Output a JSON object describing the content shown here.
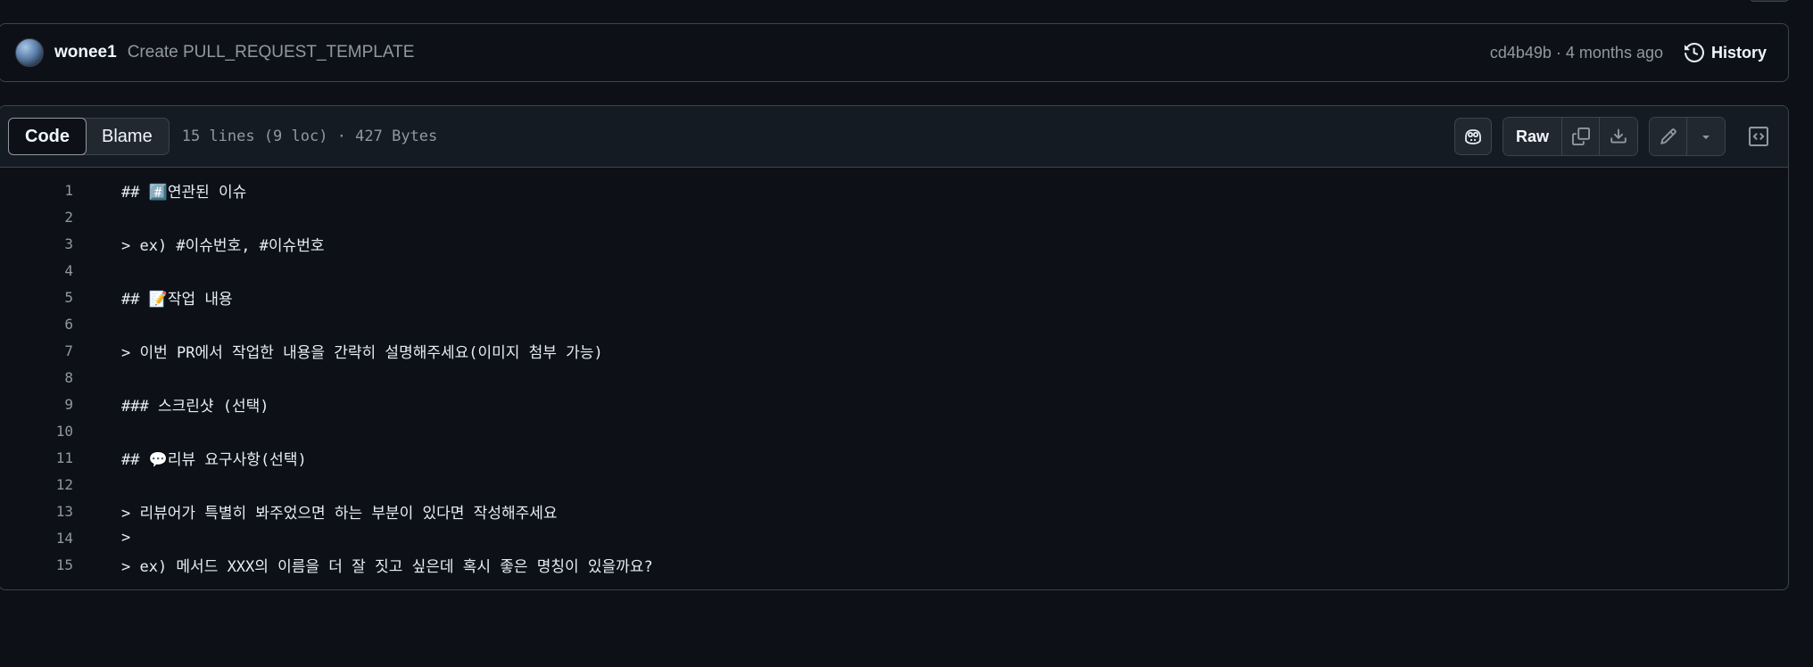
{
  "commit": {
    "author": "wonee1",
    "message": "Create PULL_REQUEST_TEMPLATE",
    "meta": "cd4b49b · 4 months ago",
    "history_label": "History"
  },
  "file_header": {
    "tabs": [
      {
        "label": "Code",
        "active": true
      },
      {
        "label": "Blame",
        "active": false
      }
    ],
    "info": "15 lines (9 loc) · 427 Bytes",
    "raw_label": "Raw"
  },
  "code_lines": [
    {
      "n": "1",
      "text": "## #️⃣연관된 이슈"
    },
    {
      "n": "2",
      "text": ""
    },
    {
      "n": "3",
      "text": "> ex) #이슈번호, #이슈번호"
    },
    {
      "n": "4",
      "text": ""
    },
    {
      "n": "5",
      "text": "## 📝작업 내용"
    },
    {
      "n": "6",
      "text": ""
    },
    {
      "n": "7",
      "text": "> 이번 PR에서 작업한 내용을 간략히 설명해주세요(이미지 첨부 가능)"
    },
    {
      "n": "8",
      "text": ""
    },
    {
      "n": "9",
      "text": "### 스크린샷 (선택)"
    },
    {
      "n": "10",
      "text": ""
    },
    {
      "n": "11",
      "text": "## 💬리뷰 요구사항(선택)"
    },
    {
      "n": "12",
      "text": ""
    },
    {
      "n": "13",
      "text": "> 리뷰어가 특별히 봐주었으면 하는 부분이 있다면 작성해주세요"
    },
    {
      "n": "14",
      "text": ">"
    },
    {
      "n": "15",
      "text": "> ex) 메서드 XXX의 이름을 더 잘 짓고 싶은데 혹시 좋은 명칭이 있을까요?"
    }
  ]
}
